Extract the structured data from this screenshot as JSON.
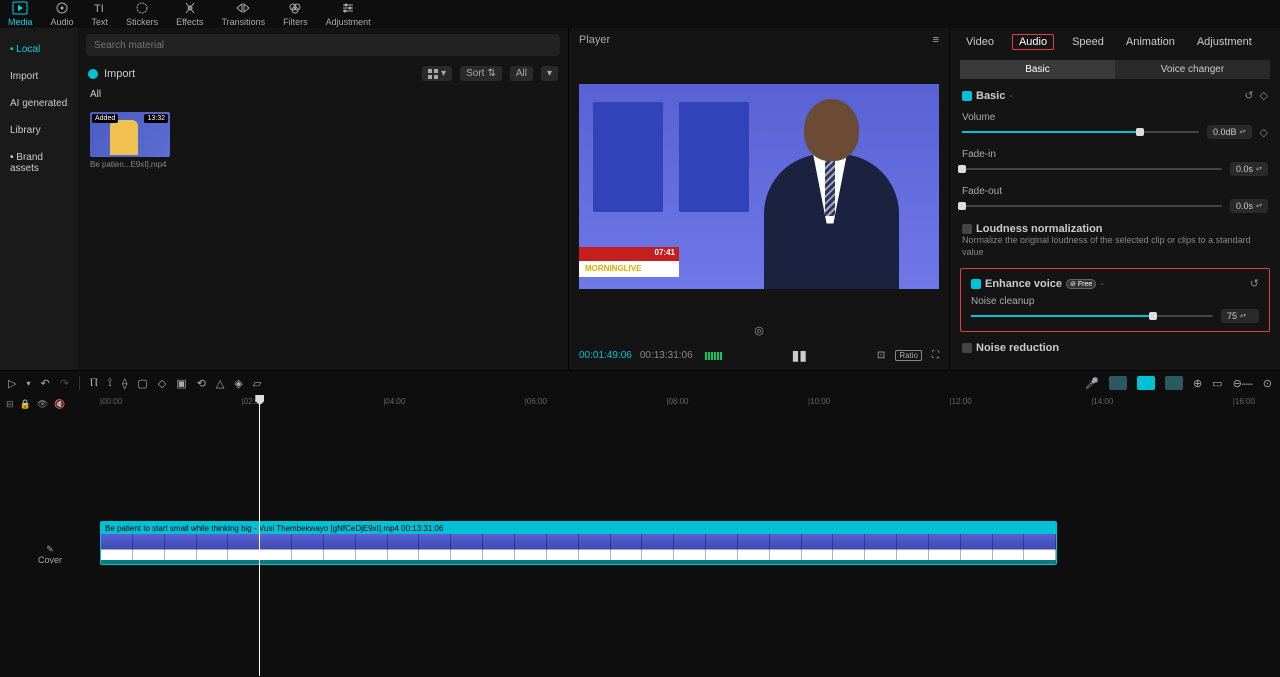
{
  "top_toolbar": {
    "items": [
      {
        "label": "Media",
        "active": true
      },
      {
        "label": "Audio"
      },
      {
        "label": "Text"
      },
      {
        "label": "Stickers"
      },
      {
        "label": "Effects"
      },
      {
        "label": "Transitions"
      },
      {
        "label": "Filters"
      },
      {
        "label": "Adjustment"
      }
    ]
  },
  "left_sidebar": {
    "items": [
      {
        "label": "Local",
        "active": true,
        "dot": true
      },
      {
        "label": "Import"
      },
      {
        "label": "AI generated"
      },
      {
        "label": "Library"
      },
      {
        "label": "Brand assets",
        "dot": true
      }
    ]
  },
  "media": {
    "search_placeholder": "Search material",
    "import_label": "Import",
    "sort_label": "Sort",
    "all_label": "All",
    "tab_all": "All",
    "thumb": {
      "added": "Added",
      "duration": "13:32",
      "filename": "Be patien...E9xI].mp4"
    }
  },
  "player": {
    "title": "Player",
    "cur_time": "00:01:49:06",
    "duration": "00:13:31:06",
    "ratio_label": "Ratio",
    "lower_third_time": "07:41",
    "lower_third_label": "MORNINGLIVE"
  },
  "inspector": {
    "tabs": [
      {
        "label": "Video"
      },
      {
        "label": "Audio",
        "active": true
      },
      {
        "label": "Speed"
      },
      {
        "label": "Animation"
      },
      {
        "label": "Adjustment"
      }
    ],
    "subtabs": [
      {
        "label": "Basic",
        "active": true
      },
      {
        "label": "Voice changer"
      }
    ],
    "basic": {
      "title": "Basic",
      "volume_label": "Volume",
      "volume_value": "0.0dB",
      "volume_pct": 75,
      "fadein_label": "Fade-in",
      "fadein_value": "0.0s",
      "fadein_pct": 0,
      "fadeout_label": "Fade-out",
      "fadeout_value": "0.0s",
      "fadeout_pct": 0
    },
    "loudness": {
      "title": "Loudness normalization",
      "desc": "Normalize the original loudness of the selected clip or clips to a standard value"
    },
    "enhance": {
      "title": "Enhance voice",
      "badge": "⊘ Free",
      "noise_label": "Noise cleanup",
      "noise_value": "75",
      "noise_pct": 75
    },
    "noise_reduction": {
      "title": "Noise reduction"
    }
  },
  "timeline": {
    "clip_title": "Be patient to start small while thinking big - Vusi Thembekwayo [gNfCeDjE9xI].mp4   00:13:31:06",
    "cover_label": "Cover",
    "ruler": [
      "00:00",
      "02:00",
      "04:00",
      "06:00",
      "08:00",
      "10:00",
      "12:00",
      "14:00",
      "16:00"
    ],
    "playhead_pct": 13.5,
    "clip_start_pct": 0,
    "clip_end_pct": 101.2
  }
}
